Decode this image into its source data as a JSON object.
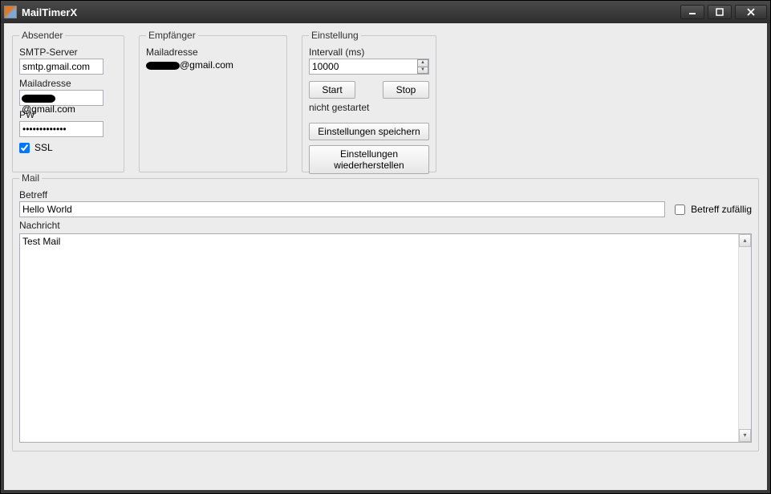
{
  "window": {
    "title": "MailTimerX"
  },
  "absender": {
    "legend": "Absender",
    "smtp_label": "SMTP-Server",
    "smtp_value": "smtp.gmail.com",
    "mail_label": "Mailadresse",
    "mail_value_suffix": "@gmail.com",
    "pw_label": "PW",
    "pw_value": "●●●●●●●●●●●●●",
    "ssl_label": "SSL",
    "ssl_checked": true
  },
  "empfaenger": {
    "legend": "Empfänger",
    "mail_label": "Mailadresse",
    "mail_value_suffix": "@gmail.com"
  },
  "einstellung": {
    "legend": "Einstellung",
    "interval_label": "Intervall (ms)",
    "interval_value": "10000",
    "start_label": "Start",
    "stop_label": "Stop",
    "status_text": "nicht gestartet",
    "save_label": "Einstellungen speichern",
    "restore_label": "Einstellungen wiederherstellen"
  },
  "mail": {
    "legend": "Mail",
    "betreff_label": "Betreff",
    "betreff_value": "Hello World",
    "random_label": "Betreff zufällig",
    "random_checked": false,
    "nachricht_label": "Nachricht",
    "nachricht_value": "Test Mail"
  }
}
